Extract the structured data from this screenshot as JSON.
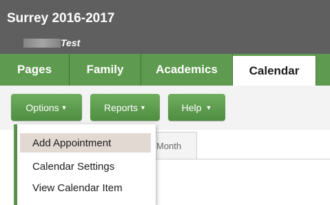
{
  "header": {
    "school_title": "Surrey 2016-2017",
    "user_name": "Test"
  },
  "tabs": [
    {
      "label": "Pages",
      "active": false
    },
    {
      "label": "Family",
      "active": false
    },
    {
      "label": "Academics",
      "active": false
    },
    {
      "label": "Calendar",
      "active": true
    }
  ],
  "toolbar": {
    "options_label": "Options",
    "reports_label": "Reports",
    "help_label": "Help"
  },
  "options_menu": {
    "items": [
      {
        "label": "Add Appointment",
        "highlighted": true
      },
      {
        "label": "Calendar Settings",
        "highlighted": false
      },
      {
        "label": "View Calendar Item",
        "highlighted": false
      }
    ]
  },
  "calendar_view": {
    "month_tab_label": "Month"
  },
  "colors": {
    "header_bg": "#5f5f5f",
    "tab_green": "#5e9a4f",
    "button_green": "#5a9a4c",
    "menu_hover": "#e3d9d3"
  },
  "icons": {
    "dropdown_caret": "caret-down-icon"
  }
}
